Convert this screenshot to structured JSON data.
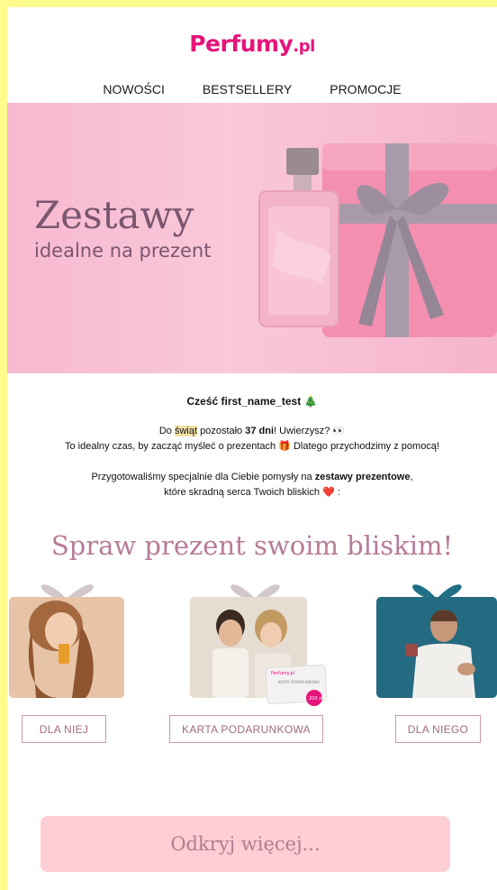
{
  "brand": {
    "name": "Perfumy",
    "tld": ".pl",
    "color": "#e6147a"
  },
  "nav": [
    "NOWOŚCI",
    "BESTSELLERY",
    "PROMOCJE"
  ],
  "hero": {
    "title": "Zestawy",
    "subtitle": "idealne na prezent"
  },
  "greeting": "Cześć first_name_test 🎄",
  "countdown": {
    "line1_prefix": "Do ",
    "line1_highlight": "świąt",
    "line1_middle": " pozostało ",
    "line1_bold": "37 dni",
    "line1_suffix": "! Uwierzysz? 👀",
    "line2": "To idealny czas, by zacząć myśleć o prezentach 🎁  Dlatego przychodzimy z pomocą!"
  },
  "intro": {
    "line1_prefix": "Przygotowaliśmy specjalnie dla Ciebie pomysły na ",
    "line1_bold": "zestawy prezentowe",
    "line1_suffix": ",",
    "line2": "które skradną serca Twoich bliskich ❤️ :"
  },
  "section_title": "Spraw prezent swoim bliskim!",
  "gift_card_text": {
    "brand": "Perfumy.pl",
    "title": "KARTA PODARUNKOWA",
    "amount": "200 zł"
  },
  "categories": [
    "DLA NIEJ",
    "KARTA PODARUNKOWA",
    "DLA NIEGO"
  ],
  "cta": "Odkryj więcej..."
}
